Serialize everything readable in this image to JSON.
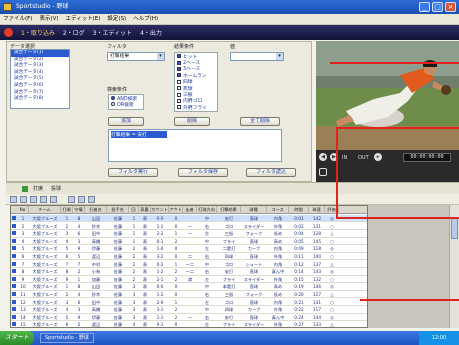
{
  "window": {
    "title": "Sportstudio - 野球",
    "buttons": [
      "_",
      "□",
      "×"
    ]
  },
  "menu": [
    "ファイル(F)",
    "表示(V)",
    "エディット(E)",
    "設定(S)",
    "ヘルプ(H)"
  ],
  "steps": [
    "1・取り込み",
    "2・ログ",
    "3・エディット",
    "4・出力"
  ],
  "filter": {
    "list_title": "データ選択",
    "list_items": [
      "試合データ(1)",
      "試合データ(2)",
      "試合データ(3)",
      "試合データ(4)",
      "試合データ(5)",
      "試合データ(6)",
      "試合データ(7)",
      "試合データ(8)"
    ],
    "dropdown1_label": "フィルタ",
    "dropdown1_value": "打撃結果",
    "checks_label": "結果条件",
    "checks": [
      "ヒット",
      "2ベース",
      "3ベース",
      "ホームラン",
      "四球",
      "死球",
      "三振",
      "内野ゴロ",
      "外野フライ"
    ],
    "dropdown2_label": "値",
    "radio_label": "検索条件",
    "radios": [
      "AND検索",
      "OR検索"
    ],
    "add_button": "追加",
    "delete_button": "削除",
    "clear_button": "全て削除",
    "condition_text": "打撃結果 = 安打",
    "filter_exec_button": "フィルタ実行",
    "filter_save_button": "フィルタ保存",
    "filter_load_button": "フィルタ読込"
  },
  "video": {
    "timecode": "00:00:00:00",
    "labels": [
      "IN",
      "OUT"
    ]
  },
  "tabs": [
    "打席",
    "投球"
  ],
  "grid": {
    "headers": [
      "No",
      "チーム",
      "打順",
      "守備",
      "打者名",
      "投手名",
      "回",
      "表裏",
      "カウント",
      "アウト",
      "走者",
      "打球方向",
      "打撃結果",
      "球種",
      "コース",
      "時間",
      "球速",
      "評価"
    ],
    "rows": [
      [
        "1",
        "大阪ブルーズ",
        "1",
        "8",
        "山田",
        "佐藤",
        "1",
        "表",
        "0-0",
        "0",
        "",
        "中",
        "安打",
        "直球",
        "内角",
        "0:01",
        "142",
        "◎"
      ],
      [
        "2",
        "大阪ブルーズ",
        "2",
        "4",
        "鈴木",
        "佐藤",
        "1",
        "表",
        "1-1",
        "0",
        "一",
        "右",
        "ゴロ",
        "スライダー",
        "外角",
        "0:02",
        "131",
        "○"
      ],
      [
        "3",
        "大阪ブルーズ",
        "3",
        "6",
        "田中",
        "佐藤",
        "1",
        "表",
        "2-2",
        "1",
        "一",
        "左",
        "三振",
        "フォーク",
        "低め",
        "0:04",
        "128",
        "△"
      ],
      [
        "4",
        "大阪ブルーズ",
        "4",
        "3",
        "高橋",
        "佐藤",
        "1",
        "表",
        "0-1",
        "2",
        "",
        "中",
        "フライ",
        "直球",
        "高め",
        "0:05",
        "145",
        "○"
      ],
      [
        "5",
        "大阪ブルーズ",
        "5",
        "9",
        "伊藤",
        "佐藤",
        "2",
        "表",
        "1-0",
        "0",
        "",
        "左",
        "二塁打",
        "カーブ",
        "内角",
        "0:09",
        "118",
        "◎"
      ],
      [
        "6",
        "大阪ブルーズ",
        "6",
        "5",
        "渡辺",
        "佐藤",
        "2",
        "表",
        "3-2",
        "0",
        "二",
        "右",
        "四球",
        "直球",
        "外角",
        "0:11",
        "140",
        "○"
      ],
      [
        "7",
        "大阪ブルーズ",
        "7",
        "7",
        "中村",
        "佐藤",
        "2",
        "表",
        "0-2",
        "1",
        "一二",
        "中",
        "ゴロ",
        "シュート",
        "内角",
        "0:12",
        "137",
        "△"
      ],
      [
        "8",
        "大阪ブルーズ",
        "8",
        "2",
        "小林",
        "佐藤",
        "2",
        "表",
        "1-2",
        "2",
        "一二",
        "右",
        "安打",
        "直球",
        "真ん中",
        "0:14",
        "143",
        "◎"
      ],
      [
        "9",
        "大阪ブルーズ",
        "9",
        "1",
        "加藤",
        "佐藤",
        "2",
        "表",
        "2-1",
        "2",
        "満",
        "左",
        "フライ",
        "スライダー",
        "外角",
        "0:15",
        "132",
        "○"
      ],
      [
        "10",
        "大阪ブルーズ",
        "1",
        "8",
        "山田",
        "佐藤",
        "3",
        "表",
        "0-0",
        "0",
        "",
        "中",
        "本塁打",
        "直球",
        "高め",
        "0:19",
        "146",
        "◎"
      ],
      [
        "11",
        "大阪ブルーズ",
        "2",
        "4",
        "鈴木",
        "佐藤",
        "3",
        "表",
        "1-2",
        "0",
        "",
        "右",
        "三振",
        "フォーク",
        "低め",
        "0:20",
        "127",
        "△"
      ],
      [
        "12",
        "大阪ブルーズ",
        "3",
        "6",
        "田中",
        "佐藤",
        "3",
        "表",
        "2-0",
        "1",
        "",
        "左",
        "ゴロ",
        "直球",
        "内角",
        "0:21",
        "141",
        "○"
      ],
      [
        "13",
        "大阪ブルーズ",
        "4",
        "3",
        "高橋",
        "佐藤",
        "3",
        "表",
        "3-1",
        "2",
        "",
        "中",
        "四球",
        "カーブ",
        "外角",
        "0:22",
        "117",
        "○"
      ],
      [
        "14",
        "大阪ブルーズ",
        "5",
        "9",
        "伊藤",
        "佐藤",
        "3",
        "表",
        "1-1",
        "2",
        "一",
        "右",
        "安打",
        "直球",
        "真ん中",
        "0:24",
        "144",
        "◎"
      ],
      [
        "15",
        "大阪ブルーズ",
        "6",
        "5",
        "渡辺",
        "佐藤",
        "4",
        "表",
        "0-1",
        "0",
        "",
        "左",
        "フライ",
        "スライダー",
        "外角",
        "0:27",
        "133",
        "△"
      ]
    ]
  },
  "taskbar": {
    "start": "スタート",
    "item": "Sportstudio - 野球",
    "clock": "12:00"
  },
  "colors": {
    "title": "#1a4fb0",
    "accent": "#2a5bd0",
    "callout": "#e0241b"
  }
}
